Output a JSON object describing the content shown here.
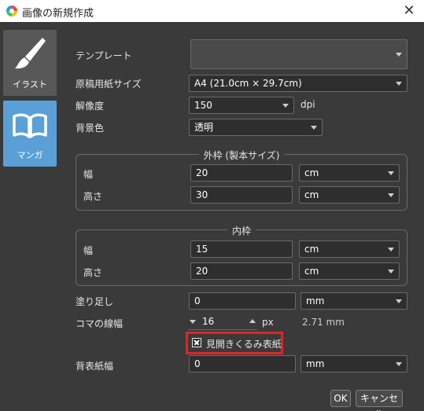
{
  "window": {
    "title": "画像の新規作成",
    "close_glyph": "✕"
  },
  "sidebar": {
    "tabs": [
      {
        "label": "イラスト",
        "icon": "paintbrush-icon"
      },
      {
        "label": "マンガ",
        "icon": "open-book-icon"
      }
    ]
  },
  "form": {
    "template": {
      "label": "テンプレート",
      "value": ""
    },
    "paper_size": {
      "label": "原稿用紙サイズ",
      "value": "A4 (21.0cm × 29.7cm)"
    },
    "resolution": {
      "label": "解像度",
      "value": "150",
      "unit": "dpi"
    },
    "bg_color": {
      "label": "背景色",
      "value": "透明"
    },
    "outer_frame": {
      "title": "外枠 (製本サイズ)",
      "width": {
        "label": "幅",
        "value": "20",
        "unit": "cm"
      },
      "height": {
        "label": "高さ",
        "value": "30",
        "unit": "cm"
      }
    },
    "inner_frame": {
      "title": "内枠",
      "width": {
        "label": "幅",
        "value": "15",
        "unit": "cm"
      },
      "height": {
        "label": "高さ",
        "value": "20",
        "unit": "cm"
      }
    },
    "bleed": {
      "label": "塗り足し",
      "value": "0",
      "unit": "mm"
    },
    "panel_line": {
      "label": "コマの線幅",
      "value": "16",
      "unit": "px",
      "converted": "2.71 mm"
    },
    "spread_cover": {
      "label": "見開きくるみ表紙",
      "checked": true
    },
    "spine": {
      "label": "背表紙幅",
      "value": "0",
      "unit": "mm"
    }
  },
  "buttons": {
    "ok": "OK",
    "cancel": "キャンセル"
  },
  "colors": {
    "accent": "#5a9fd6",
    "highlight": "#e0242a"
  }
}
